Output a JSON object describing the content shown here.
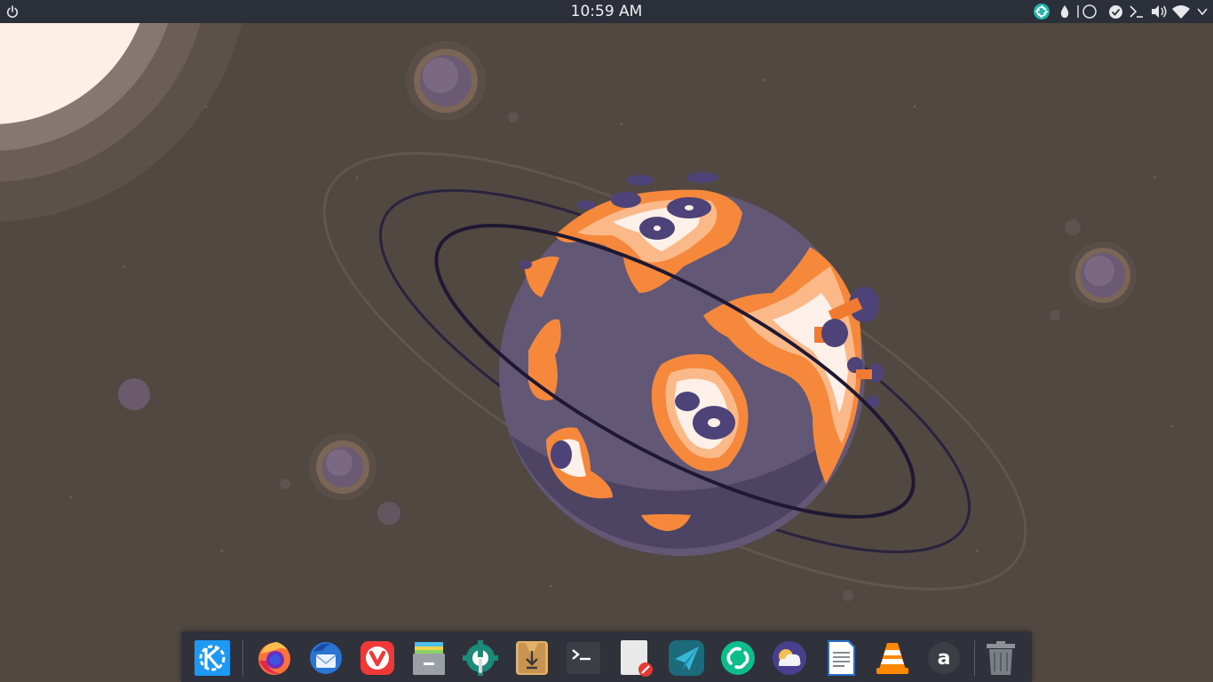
{
  "panel": {
    "clock": "10:59 AM",
    "power_icon": "power-icon",
    "tray_icons": [
      "screenshot-app-icon",
      "color-picker-drop-icon",
      "activity-circle-icon",
      "updates-check-icon",
      "console-icon",
      "volume-icon",
      "wifi-icon"
    ]
  },
  "dock": {
    "items": [
      {
        "name": "KDE Application Launcher",
        "icon": "kde-icon"
      },
      {
        "name": "Firefox",
        "icon": "firefox-icon"
      },
      {
        "name": "Thunderbird",
        "icon": "thunderbird-icon"
      },
      {
        "name": "Vivaldi",
        "icon": "vivaldi-icon"
      },
      {
        "name": "File Manager",
        "icon": "file-manager-icon"
      },
      {
        "name": "System Settings",
        "icon": "settings-icon"
      },
      {
        "name": "Software Center",
        "icon": "software-center-icon"
      },
      {
        "name": "Terminal",
        "icon": "terminal-icon"
      },
      {
        "name": "Text Editor",
        "icon": "text-editor-icon"
      },
      {
        "name": "Telegram",
        "icon": "telegram-icon"
      },
      {
        "name": "Element",
        "icon": "element-icon"
      },
      {
        "name": "Weather",
        "icon": "weather-icon"
      },
      {
        "name": "Writer",
        "icon": "writer-icon"
      },
      {
        "name": "VLC",
        "icon": "vlc-icon"
      },
      {
        "name": "Amazon",
        "icon": "amazon-icon"
      },
      {
        "name": "Trash",
        "icon": "trash-icon"
      }
    ]
  },
  "colors": {
    "panel_bg": "#2b2f3a",
    "dock_bg": "#2f323b",
    "wallpaper_bg": "#524842",
    "planet_purple": "#625775",
    "planet_orange": "#f5883b",
    "accent_teal": "#1fb5a8"
  }
}
